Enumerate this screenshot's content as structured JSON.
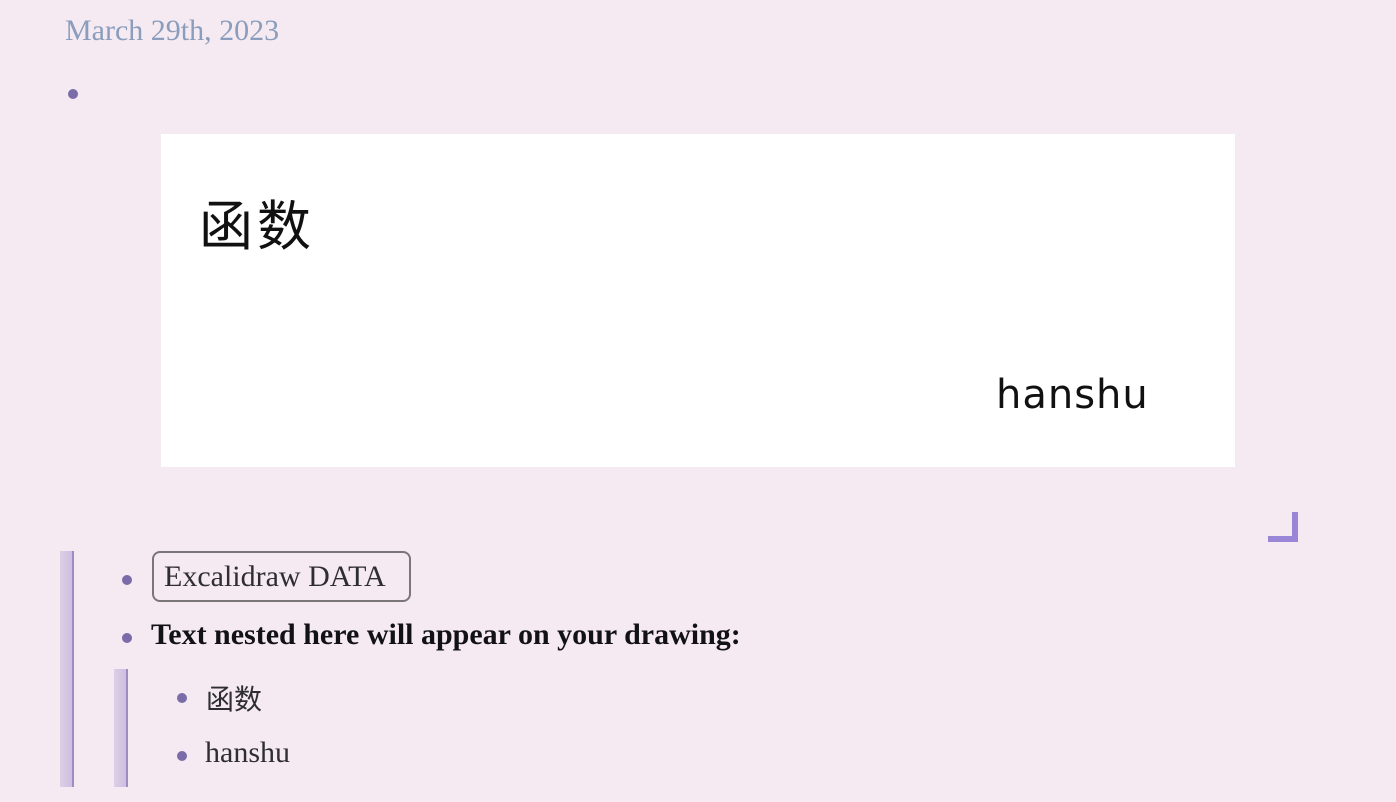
{
  "page": {
    "title": "March 29th, 2023"
  },
  "drawing": {
    "text_chinese": "函数",
    "text_pinyin": "hanshu"
  },
  "blocks": {
    "tag_label": "Excalidraw DATA",
    "instruction": "Text nested here will appear on your drawing:",
    "nested_items": [
      "函数",
      "hanshu"
    ]
  },
  "colors": {
    "background": "#f5eaf1",
    "bullet": "#7b6ba8",
    "title": "#8a9dbc",
    "accent": "#9d8cc4"
  }
}
